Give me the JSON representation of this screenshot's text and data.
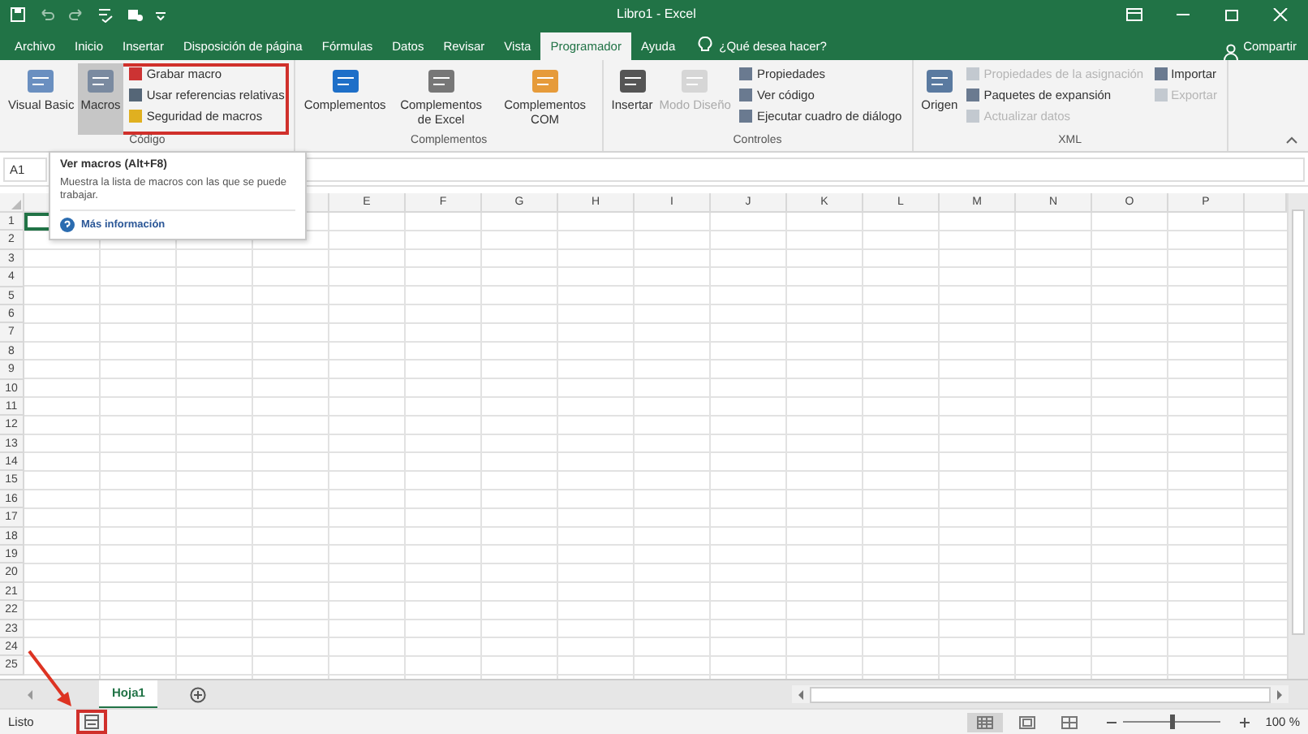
{
  "window": {
    "title": "Libro1  -  Excel"
  },
  "tabs": [
    {
      "label": "Archivo",
      "selected": false
    },
    {
      "label": "Inicio",
      "selected": false
    },
    {
      "label": "Insertar",
      "selected": false
    },
    {
      "label": "Disposición de página",
      "selected": false
    },
    {
      "label": "Fórmulas",
      "selected": false
    },
    {
      "label": "Datos",
      "selected": false
    },
    {
      "label": "Revisar",
      "selected": false
    },
    {
      "label": "Vista",
      "selected": false
    },
    {
      "label": "Programador",
      "selected": true
    },
    {
      "label": "Ayuda",
      "selected": false
    }
  ],
  "tell_me": {
    "placeholder": "¿Qué desea hacer?"
  },
  "share": "Compartir",
  "ribbon": [
    {
      "label": "Código",
      "items": [
        {
          "kind": "large",
          "label": "Visual Basic",
          "highlighted": false,
          "pressed": false,
          "disabled": false
        },
        {
          "kind": "large",
          "label": "Macros",
          "highlighted": true,
          "pressed": true,
          "disabled": false
        },
        {
          "kind": "stack",
          "highlighted": true,
          "items": [
            {
              "label": "Grabar macro",
              "disabled": false
            },
            {
              "label": "Usar referencias relativas",
              "disabled": false
            },
            {
              "label": "Seguridad de macros",
              "disabled": false
            }
          ]
        }
      ]
    },
    {
      "label": "Complementos",
      "items": [
        {
          "kind": "large",
          "label": "Complementos",
          "highlighted": false,
          "pressed": false,
          "disabled": false
        },
        {
          "kind": "large",
          "label": "Complementos de Excel",
          "highlighted": false,
          "pressed": false,
          "disabled": false
        },
        {
          "kind": "large",
          "label": "Complementos COM",
          "highlighted": false,
          "pressed": false,
          "disabled": false
        }
      ]
    },
    {
      "label": "Controles",
      "items": [
        {
          "kind": "large",
          "label": "Insertar",
          "highlighted": false,
          "pressed": false,
          "disabled": false
        },
        {
          "kind": "large",
          "label": "Modo Diseño",
          "highlighted": false,
          "pressed": false,
          "disabled": true
        },
        {
          "kind": "stack",
          "highlighted": false,
          "items": [
            {
              "label": "Propiedades",
              "disabled": false
            },
            {
              "label": "Ver código",
              "disabled": false
            },
            {
              "label": "Ejecutar cuadro de diálogo",
              "disabled": false
            }
          ]
        }
      ]
    },
    {
      "label": "XML",
      "items": [
        {
          "kind": "large",
          "label": "Origen",
          "highlighted": false,
          "pressed": false,
          "disabled": false
        },
        {
          "kind": "stack",
          "highlighted": false,
          "items": [
            {
              "label": "Propiedades de la asignación",
              "disabled": true
            },
            {
              "label": "Paquetes de expansión",
              "disabled": false
            },
            {
              "label": "Actualizar datos",
              "disabled": true
            }
          ]
        },
        {
          "kind": "stack",
          "highlighted": false,
          "items": [
            {
              "label": "Importar",
              "disabled": false
            },
            {
              "label": "Exportar",
              "disabled": true
            }
          ]
        }
      ]
    }
  ],
  "tooltip": {
    "title": "Ver macros (Alt+F8)",
    "text": "Muestra la lista de macros con las que se puede trabajar.",
    "link": "Más información"
  },
  "name_box": "A1",
  "columns": [
    "E",
    "F",
    "G",
    "H",
    "I",
    "J",
    "K",
    "L",
    "M",
    "N",
    "O",
    "P"
  ],
  "rows": [
    "1",
    "2",
    "3",
    "4",
    "5",
    "6",
    "7",
    "8",
    "9",
    "10",
    "11",
    "12",
    "13",
    "14",
    "15",
    "16",
    "17",
    "18",
    "19",
    "20",
    "21",
    "22",
    "23",
    "24",
    "25"
  ],
  "sheets": [
    {
      "label": "Hoja1",
      "selected": true
    }
  ],
  "status_bar": {
    "text": "Listo",
    "macro_highlighted": true,
    "views": [
      {
        "selected": true
      },
      {
        "selected": false
      },
      {
        "selected": false
      }
    ],
    "zoom": {
      "level": 0.5,
      "reading": "100 %"
    }
  }
}
